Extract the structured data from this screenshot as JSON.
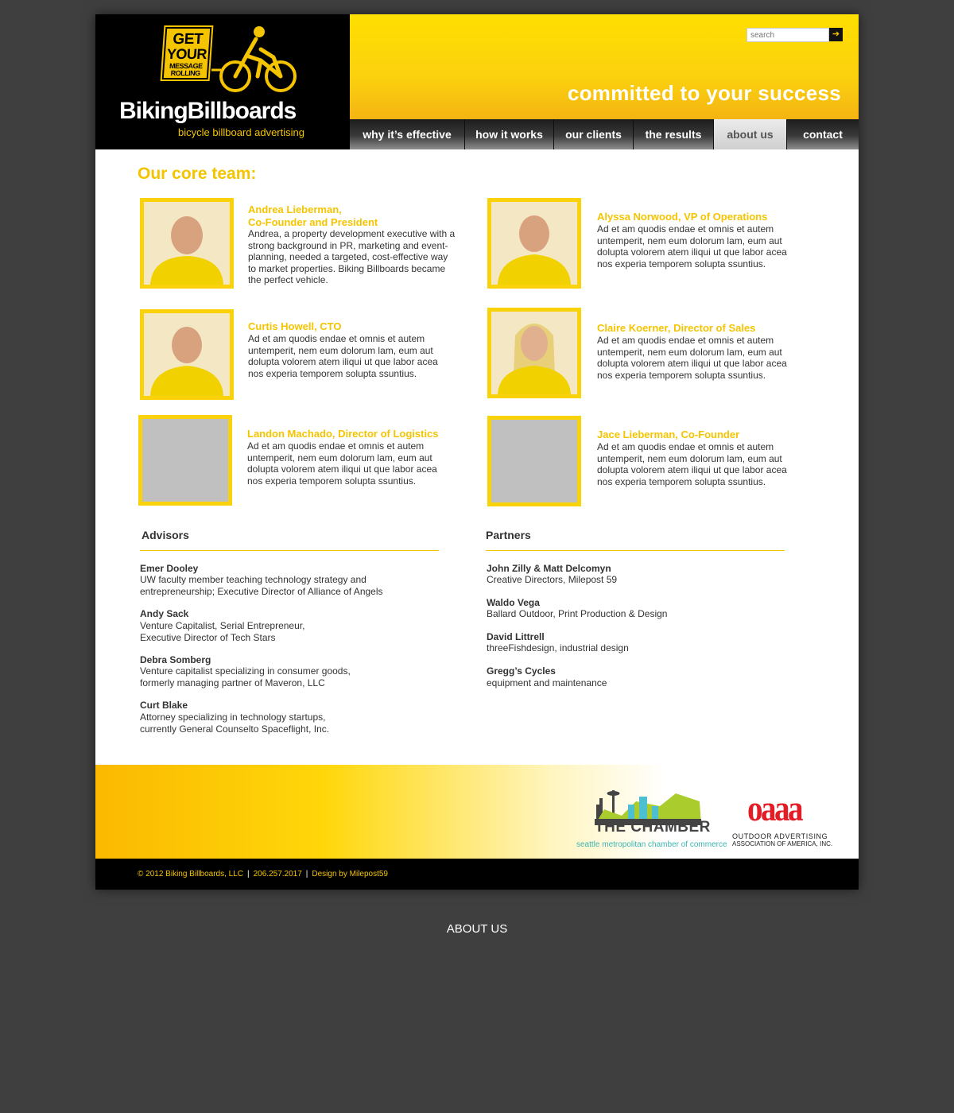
{
  "header": {
    "logo_sign": [
      "GET",
      "YOUR",
      "MESSAGE",
      "ROLLING"
    ],
    "logo_name": "BikingBillboards",
    "logo_tagline": "bicycle billboard advertising",
    "search_placeholder": "search",
    "tagline": "committed to your success"
  },
  "nav": [
    {
      "label": "why it’s effective",
      "active": false
    },
    {
      "label": "how it works",
      "active": false
    },
    {
      "label": "our clients",
      "active": false
    },
    {
      "label": "the results",
      "active": false
    },
    {
      "label": "about us",
      "active": true
    },
    {
      "label": "contact",
      "active": false
    }
  ],
  "core_team": {
    "title": "Our core team:",
    "members": [
      {
        "name": "Andrea Lieberman,\nCo-Founder and President",
        "bio": " Andrea, a property development executive with a strong background in PR, marketing and event-planning, needed a targeted, cost-effective way to market properties. Biking Billboards became the perfect vehicle.",
        "photo": "portrait"
      },
      {
        "name": "Alyssa Norwood, VP of Operations",
        "bio": "Ad et am quodis endae et omnis et autem untemperit, nem eum dolorum lam, eum aut dolupta volorem atem iliqui ut que labor acea nos experia temporem solupta ssuntius.",
        "photo": "portrait"
      },
      {
        "name": "Curtis Howell, CTO",
        "bio": "Ad et am quodis endae et omnis et autem untemperit, nem eum dolorum lam, eum aut dolupta volorem atem iliqui ut que labor acea nos experia temporem solupta ssuntius.",
        "photo": "portrait"
      },
      {
        "name": "Claire Koerner, Director of Sales",
        "bio": "Ad et am quodis endae et omnis et autem untemperit, nem eum dolorum lam, eum aut dolupta volorem atem iliqui ut que labor acea nos experia temporem solupta ssuntius.",
        "photo": "portrait"
      },
      {
        "name": "Landon Machado, Director of Logistics",
        "bio": "Ad et am quodis endae et omnis et autem untemperit, nem eum dolorum lam, eum aut dolupta volorem atem iliqui ut que labor acea nos experia temporem solupta ssuntius.",
        "photo": "placeholder"
      },
      {
        "name": "Jace Lieberman, Co-Founder",
        "bio": "Ad et am quodis endae et omnis et autem untemperit, nem eum dolorum lam, eum aut dolupta volorem atem iliqui ut que labor acea nos experia temporem solupta ssuntius.",
        "photo": "placeholder"
      }
    ]
  },
  "advisors": {
    "title": "Advisors",
    "people": [
      {
        "name": "Emer Dooley",
        "desc": "UW faculty member teaching technology strategy and\nentrepreneurship; Executive Director of Alliance of Angels"
      },
      {
        "name": "Andy Sack",
        "desc": "Venture Capitalist, Serial Entrepreneur,\nExecutive Director of Tech Stars"
      },
      {
        "name": "Debra Somberg",
        "desc": "Venture capitalist specializing in consumer goods,\nformerly managing partner of Maveron, LLC"
      },
      {
        "name": "Curt Blake",
        "desc": "Attorney specializing in technology startups,\ncurrently General Counselto Spaceflight, Inc."
      }
    ]
  },
  "partners": {
    "title": "Partners",
    "people": [
      {
        "name": "John Zilly & Matt Delcomyn",
        "desc": "Creative Directors, Milepost 59"
      },
      {
        "name": "Waldo Vega",
        "desc": "Ballard Outdoor, Print Production & Design"
      },
      {
        "name": "David Littrell",
        "desc": "threeFishdesign, industrial design"
      },
      {
        "name": "Gregg’s Cycles",
        "desc": "equipment and maintenance"
      }
    ]
  },
  "sponsors": {
    "chamber_name": "THE CHAMBER",
    "chamber_sub": "seattle metropolitan chamber of commerce",
    "oaaa_mark": "oaaa",
    "oaaa_line1": "OUTDOOR ADVERTISING",
    "oaaa_line2": "ASSOCIATION OF AMERICA, INC."
  },
  "footer": {
    "copyright": "© 2012 Biking Billboards, LLC",
    "phone": "206.257.2017",
    "credit": "Design by Milepost59"
  },
  "page_label": "ABOUT US",
  "colors": {
    "accent": "#f5c400",
    "background": "#3f3f3f",
    "header_black": "#000000"
  }
}
